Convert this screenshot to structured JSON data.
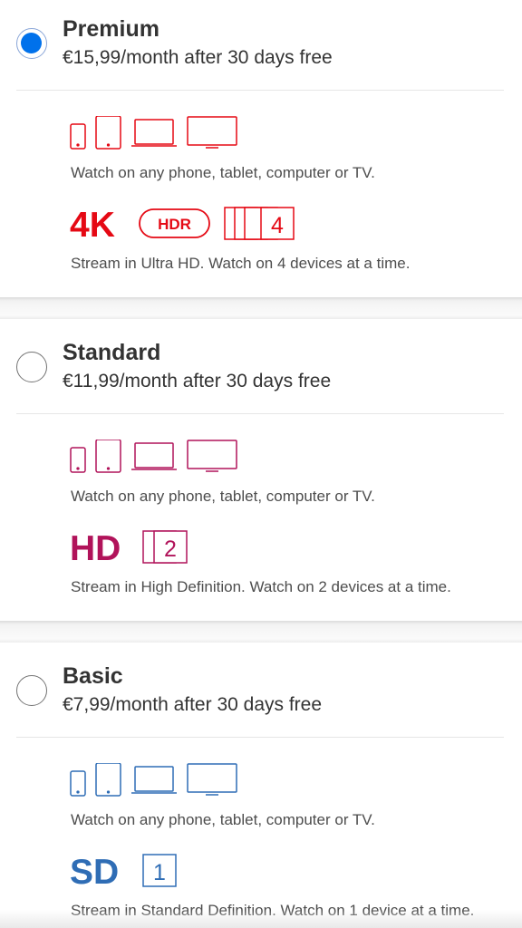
{
  "plans": [
    {
      "name": "Premium",
      "price": "€15,99/month after 30 days free",
      "selected": true,
      "color": "#e50914",
      "devices_text": "Watch on any phone, tablet, computer or TV.",
      "quality_label": "4K",
      "hdr_label": "HDR",
      "screens": "4",
      "stream_text": "Stream in Ultra HD. Watch on 4 devices at a time."
    },
    {
      "name": "Standard",
      "price": "€11,99/month after 30 days free",
      "selected": false,
      "color": "#b1135a",
      "devices_text": "Watch on any phone, tablet, computer or TV.",
      "quality_label": "HD",
      "screens": "2",
      "stream_text": "Stream in High Definition. Watch on 2 devices at a time."
    },
    {
      "name": "Basic",
      "price": "€7,99/month after 30 days free",
      "selected": false,
      "color": "#2f6db5",
      "devices_text": "Watch on any phone, tablet, computer or TV.",
      "quality_label": "SD",
      "screens": "1",
      "stream_text": "Stream in Standard Definition. Watch on 1 device at a time."
    }
  ],
  "icons": [
    "phone-icon",
    "tablet-icon",
    "laptop-icon",
    "tv-icon"
  ]
}
